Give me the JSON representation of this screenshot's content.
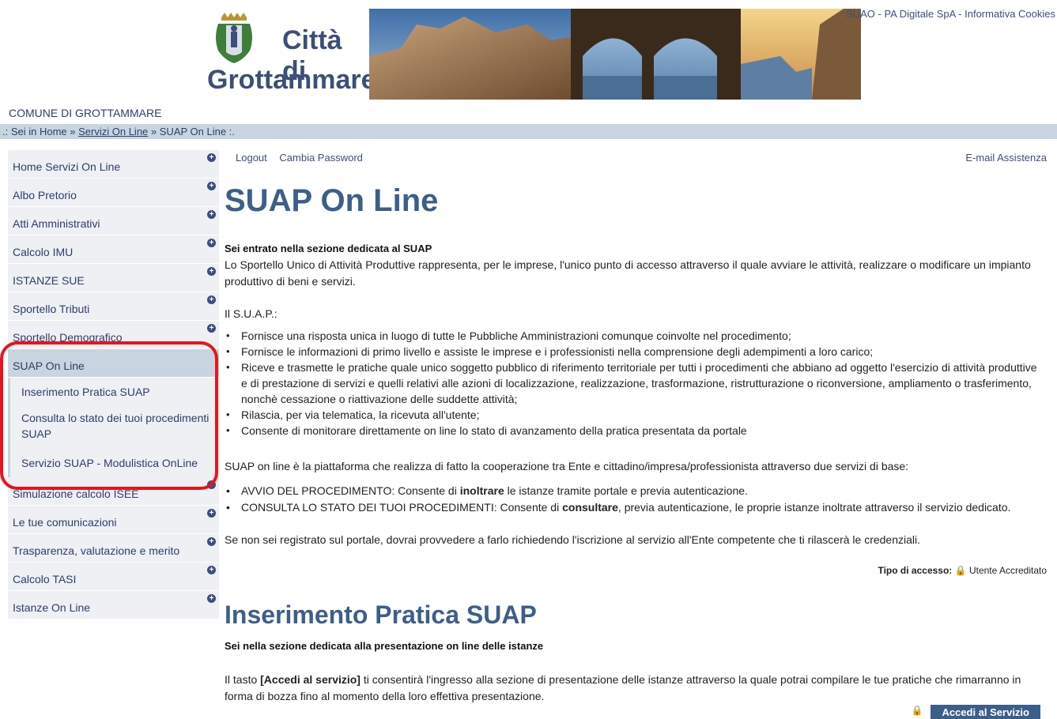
{
  "header": {
    "logo_line1": "Città di",
    "logo_line2": "Grottammare",
    "top_links": "SUAO - PA Digitale SpA - Informativa Cookies"
  },
  "comune": "COMUNE DI GROTTAMMARE",
  "breadcrumb": {
    "prefix": ".: Sei in Home »",
    "link": "Servizi On Line",
    "sep": "»",
    "current": "SUAP On Line :."
  },
  "sidebar": {
    "items": [
      {
        "label": "Home Servizi On Line"
      },
      {
        "label": "Albo Pretorio"
      },
      {
        "label": "Atti Amministrativi"
      },
      {
        "label": "Calcolo IMU"
      },
      {
        "label": "ISTANZE SUE"
      },
      {
        "label": "Sportello Tributi"
      },
      {
        "label": "Sportello Demografico"
      },
      {
        "label": "SUAP On Line"
      },
      {
        "label": "Simulazione calcolo ISEE"
      },
      {
        "label": "Le tue comunicazioni"
      },
      {
        "label": "Trasparenza, valutazione e merito"
      },
      {
        "label": "Calcolo TASI"
      },
      {
        "label": "Istanze On Line"
      }
    ],
    "subitems": [
      {
        "label": "Inserimento Pratica SUAP"
      },
      {
        "label": "Consulta lo stato dei tuoi procedimenti SUAP"
      },
      {
        "label": "Servizio SUAP - Modulistica OnLine"
      }
    ],
    "plus_glyph": "+"
  },
  "main": {
    "logout": "Logout",
    "cambia_password": "Cambia Password",
    "email_assistenza": "E-mail Assistenza",
    "title": "SUAP On Line",
    "intro_bold": "Sei entrato nella sezione dedicata al SUAP",
    "intro": "Lo Sportello Unico di Attività Produttive rappresenta, per le imprese, l'unico punto di accesso attraverso il quale avviare le attività, realizzare o modificare un impianto produttivo di beni e servizi.",
    "suap_label": "Il S.U.A.P.:",
    "bullets": [
      "Fornisce una risposta unica in luogo di tutte le Pubbliche Amministrazioni comunque coinvolte nel procedimento;",
      "Fornisce le informazioni di primo livello e assiste le imprese e i professionisti nella comprensione degli adempimenti a loro carico;",
      "Riceve e trasmette le pratiche quale unico soggetto pubblico di riferimento territoriale per tutti i procedimenti che abbiano ad oggetto l'esercizio di attività produttive e di prestazione di servizi e quelli relativi alle azioni di localizzazione, realizzazione, trasformazione, ristrutturazione o riconversione, ampliamento o trasferimento, nonchè cessazione o riattivazione delle suddette attività;",
      "Rilascia, per via telematica, la ricevuta all'utente;",
      "Consente di monitorare direttamente on line lo stato di avanzamento della pratica presentata da portale"
    ],
    "cooperazione": "SUAP on line è la piattaforma che realizza di fatto la cooperazione tra Ente e cittadino/impresa/professionista attraverso due servizi di base:",
    "bullets2": [
      {
        "pre": "AVVIO DEL PROCEDIMENTO: Consente di ",
        "bold": "inoltrare",
        "post": " le istanze tramite portale e previa autenticazione."
      },
      {
        "pre": "CONSULTA LO STATO DEI TUOI PROCEDIMENTI: Consente di ",
        "bold": "consultare",
        "post": ", previa autenticazione, le proprie istanze inoltrate attraverso il servizio dedicato."
      }
    ],
    "registrato": "Se non sei registrato sul portale, dovrai provvedere a farlo richiedendo l'iscrizione al servizio all'Ente competente che ti rilascerà le credenziali.",
    "tipo_label": "Tipo di accesso:",
    "tipo_value": "Utente Accreditato",
    "title2": "Inserimento Pratica SUAP",
    "sez_bold": "Sei nella sezione dedicata alla presentazione on line delle istanze",
    "tasto_pre": "Il tasto ",
    "tasto_bold": "[Accedi al servizio]",
    "tasto_post": " ti consentirà l'ingresso alla sezione di presentazione delle istanze attraverso la quale potrai compilare le tue pratiche che rimarranno in forma di bozza fino al momento della loro effettiva presentazione.",
    "accedi_button": "Accedi al Servizio",
    "lock_glyph": "🔒"
  }
}
